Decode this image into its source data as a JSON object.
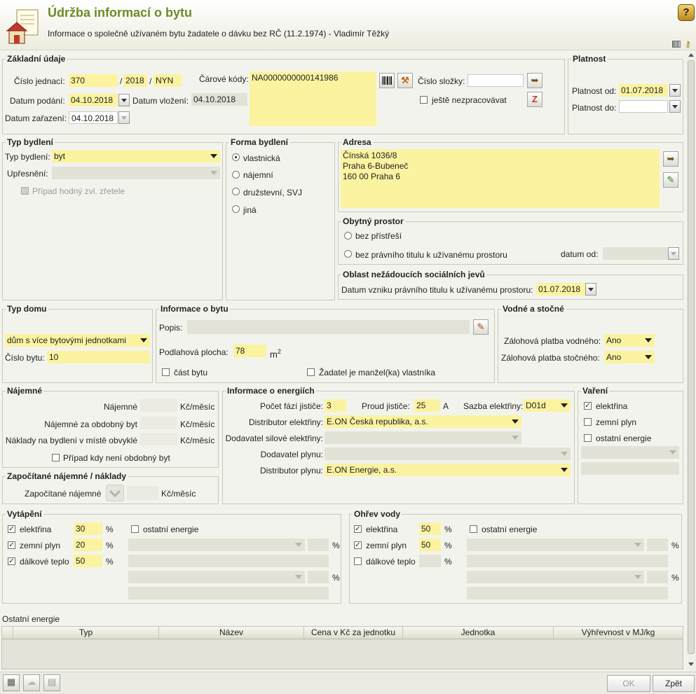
{
  "header": {
    "title": "Údržba informací o bytu",
    "subtitle": "Informace o společně užívaném bytu žadatele o dávku bez RČ (11.2.1974) - Vladimír Těžký",
    "help_icon": "?"
  },
  "zakladni": {
    "legend": "Základní údaje",
    "cislo_jednaci_label": "Číslo jednací:",
    "cj1": "370",
    "sep1": "/",
    "cj2": "2018",
    "sep2": "/",
    "cj3": "NYN",
    "carove_kody_label": "Čárové kódy:",
    "carove_kody_value": "NA0000000000141986",
    "cislo_slozky_label": "Číslo složky:",
    "cislo_slozky_value": "",
    "datum_podani_label": "Datum podání:",
    "datum_podani_value": "04.10.2018",
    "datum_vlozeni_label": "Datum vložení:",
    "datum_vlozeni_value": "04.10.2018",
    "datum_zarazeni_label": "Datum zařazení:",
    "datum_zarazeni_value": "04.10.2018",
    "jeste_label": "ještě nezpracovávat"
  },
  "platnost": {
    "legend": "Platnost",
    "od_label": "Platnost od:",
    "od_value": "01.07.2018",
    "do_label": "Platnost do:",
    "do_value": ""
  },
  "typ_bydleni": {
    "legend": "Typ bydlení",
    "typ_label": "Typ bydlení:",
    "typ_value": "byt",
    "upresneni_label": "Upřesnění:",
    "upresneni_value": "",
    "pripad_label": "Případ hodný zvl. zřetele"
  },
  "forma": {
    "legend": "Forma bydlení",
    "options": [
      "vlastnická",
      "nájemní",
      "družstevní, SVJ",
      "jiná"
    ]
  },
  "adresa": {
    "legend": "Adresa",
    "line1": "Čínská 1036/8",
    "line2": "Praha 6-Bubeneč",
    "line3": "160 00 Praha 6"
  },
  "obytny": {
    "legend": "Obytný prostor",
    "opt1": "bez přístřeší",
    "opt2": "bez právního titulu k užívanému prostoru",
    "datum_od_label": "datum od:",
    "datum_od_value": ""
  },
  "oblast": {
    "legend": "Oblast nežádoucích sociálních jevů",
    "datum_label": "Datum vzniku právního titulu k užívanému prostoru:",
    "datum_value": "01.07.2018"
  },
  "typ_domu": {
    "legend": "Typ domu",
    "value": "dům s více bytovými jednotkami",
    "cislo_label": "Číslo bytu:",
    "cislo_value": "10"
  },
  "info_byt": {
    "legend": "Informace o bytu",
    "popis_label": "Popis:",
    "popis_value": "",
    "plocha_label": "Podlahová plocha:",
    "plocha_value": "78",
    "plocha_unit": "m",
    "plocha_sup": "2",
    "cast_label": "část bytu",
    "zadatel_label": "Žadatel je manžel(ka) vlastníka"
  },
  "vodne": {
    "legend": "Vodné a stočné",
    "vodne_label": "Zálohová platba vodného:",
    "vodne_value": "Ano",
    "stocne_label": "Zálohová platba stočného:",
    "stocne_value": "Ano"
  },
  "najemne": {
    "legend": "Nájemné",
    "najemne_label": "Nájemné",
    "obdobny_label": "Nájemné za obdobný byt",
    "naklady_label": "Náklady na bydlení v místě obvyklé",
    "unit": "Kč/měsíc",
    "pripad_label": "Případ kdy není obdobný byt"
  },
  "zapocitane": {
    "legend": "Započítané nájemné / náklady",
    "label": "Započítané nájemné",
    "unit": "Kč/měsíc"
  },
  "energie": {
    "legend": "Informace o energiích",
    "pocet_label": "Počet fází jističe:",
    "pocet_value": "3",
    "proud_label": "Proud jističe:",
    "proud_value": "25",
    "proud_unit": "A",
    "sazba_label": "Sazba elektřiny:",
    "sazba_value": "D01d",
    "dist_el_label": "Distributor elektřiny:",
    "dist_el_value": "E.ON Česká republika, a.s.",
    "dod_sil_label": "Dodavatel silové elektřiny:",
    "dod_sil_value": "",
    "dod_plyn_label": "Dodavatel plynu:",
    "dod_plyn_value": "",
    "dist_plyn_label": "Distributor plynu:",
    "dist_plyn_value": "E.ON Energie, a.s."
  },
  "vareni": {
    "legend": "Vaření",
    "opt1": "elektřina",
    "opt2": "zemní plyn",
    "opt3": "ostatní energie"
  },
  "vytapeni": {
    "legend": "Vytápění",
    "el_label": "elektřina",
    "el_value": "30",
    "zp_label": "zemní plyn",
    "zp_value": "20",
    "dt_label": "dálkové teplo",
    "dt_value": "50",
    "ost_label": "ostatní energie",
    "pct": "%"
  },
  "ohrev": {
    "legend": "Ohřev vody",
    "el_label": "elektřina",
    "el_value": "50",
    "zp_label": "zemní plyn",
    "zp_value": "50",
    "dt_label": "dálkové teplo",
    "dt_value": "",
    "ost_label": "ostatní energie",
    "pct": "%"
  },
  "ostatni": {
    "title": "Ostatní energie",
    "columns": [
      "Typ",
      "Název",
      "Cena v Kč za jednotku",
      "Jednotka",
      "Výhřevnost v MJ/kg"
    ]
  },
  "footer": {
    "ok_label": "OK",
    "zpet_label": "Zpět"
  }
}
